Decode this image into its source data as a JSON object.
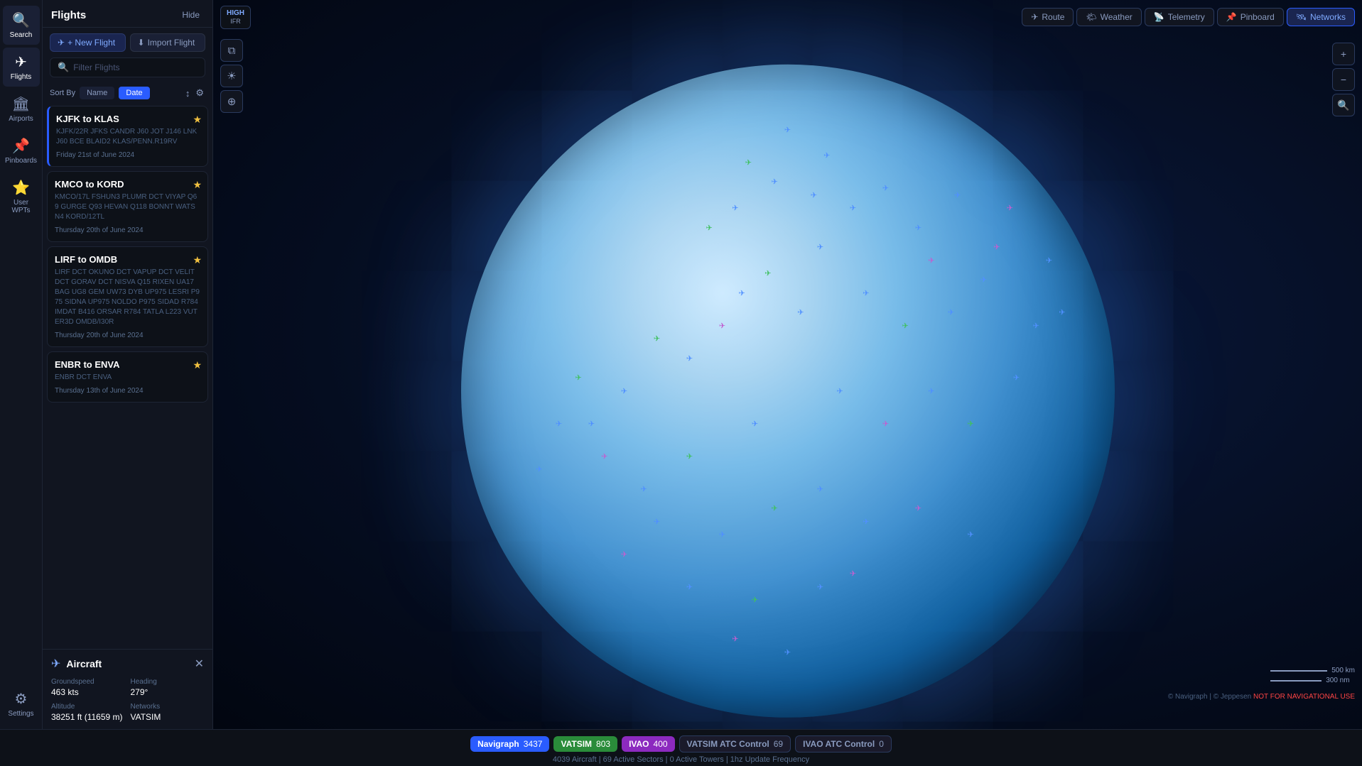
{
  "app": {
    "title": "Navigraph"
  },
  "topbar": {
    "tabs": [
      {
        "id": "route",
        "label": "Route",
        "icon": "✈",
        "active": false
      },
      {
        "id": "weather",
        "label": "Weather",
        "icon": "🌤",
        "active": false
      },
      {
        "id": "telemetry",
        "label": "Telemetry",
        "icon": "📡",
        "active": false
      },
      {
        "id": "pinboard",
        "label": "Pinboard",
        "icon": "📌",
        "active": false
      },
      {
        "id": "networks",
        "label": "Networks",
        "icon": "🛰",
        "active": true
      }
    ]
  },
  "sidebar": {
    "items": [
      {
        "id": "search",
        "label": "Search",
        "icon": "🔍",
        "active": false
      },
      {
        "id": "flights",
        "label": "Flights",
        "icon": "✈",
        "active": true
      },
      {
        "id": "airports",
        "label": "Airports",
        "icon": "🏛",
        "active": false
      },
      {
        "id": "pinboards",
        "label": "Pinboards",
        "icon": "📌",
        "active": false
      },
      {
        "id": "user-wpts",
        "label": "User WPTs",
        "icon": "⭐",
        "active": false
      },
      {
        "id": "settings",
        "label": "Settings",
        "icon": "⚙",
        "active": false
      }
    ]
  },
  "flights_panel": {
    "title": "Flights",
    "hide_label": "Hide",
    "new_flight_label": "+ New Flight",
    "import_flight_label": "Import Flight",
    "search_placeholder": "Filter Flights",
    "sort_label": "Sort By",
    "sort_name_label": "Name",
    "sort_date_label": "Date",
    "flights": [
      {
        "id": 1,
        "route": "KJFK to KLAS",
        "waypoints": "KJFK/22R JFKS CANDR J60 JOT J146 LNK J60 BCE BLAID2 KLAS/PENN.R19RV",
        "date": "Friday 21st of June 2024",
        "starred": true,
        "selected": true
      },
      {
        "id": 2,
        "route": "KMCO to KORD",
        "waypoints": "KMCO/17L FSHUN3 PLUMR DCT VIYAP Q69 GURGE Q93 HEVAN Q118 BONNT WATSN4 KORD/12TL",
        "date": "Thursday 20th of June 2024",
        "starred": true,
        "selected": false
      },
      {
        "id": 3,
        "route": "LIRF to OMDB",
        "waypoints": "LIRF DCT OKUNO DCT VAPUP DCT VELIT DCT GORAV DCT NISVA Q15 RIXEN UA17 BAG UG8 GEM UW73 DYB UP975 LESRI P975 SIDNA UP975 NOLDO P975 SIDAD R784 IMDAT B416 ORSAR R784 TATLA L223 VUTER3D OMDB/I30R",
        "date": "Thursday 20th of June 2024",
        "starred": true,
        "selected": false
      },
      {
        "id": 4,
        "route": "ENBR to ENVA",
        "waypoints": "ENBR DCT ENVA",
        "date": "Thursday 13th of June 2024",
        "starred": true,
        "selected": false
      }
    ]
  },
  "aircraft_panel": {
    "title": "Aircraft",
    "groundspeed_label": "Groundspeed",
    "groundspeed_value": "463 kts",
    "heading_label": "Heading",
    "heading_value": "279°",
    "altitude_label": "Altitude",
    "altitude_value": "38251 ft (11659 m)",
    "networks_label": "Networks",
    "networks_value": "VATSIM"
  },
  "map_toolbar": {
    "ifr_high_label": "HIGH",
    "ifr_label": "IFR",
    "route_label": "Route",
    "weather_label": "Weather",
    "telemetry_label": "Telemetry",
    "pinboard_label": "Pinboard",
    "networks_label": "Networks"
  },
  "status_bar": {
    "networks": [
      {
        "id": "nav",
        "label": "Navigraph",
        "count": "3437",
        "class": "nav"
      },
      {
        "id": "vatsim",
        "label": "VATSIM",
        "count": "803",
        "class": "vatsim"
      },
      {
        "id": "ivao",
        "label": "IVAO",
        "count": "400",
        "class": "ivao"
      },
      {
        "id": "vatsim-atc",
        "label": "VATSIM ATC Control",
        "count": "69",
        "class": "vatsim-atc"
      },
      {
        "id": "ivao-atc",
        "label": "IVAO ATC Control",
        "count": "0",
        "class": "ivao-atc"
      }
    ],
    "info": "4039 Aircraft  |  69 Active Sectors  |  0 Active Towers  |  1hz Update Frequency"
  },
  "map_scale": {
    "scale1_label": "500 km",
    "scale2_label": "300 nm"
  },
  "copyright": {
    "text": "© Navigraph | © Jeppesen",
    "warning": "NOT FOR NAVIGATIONAL USE"
  }
}
